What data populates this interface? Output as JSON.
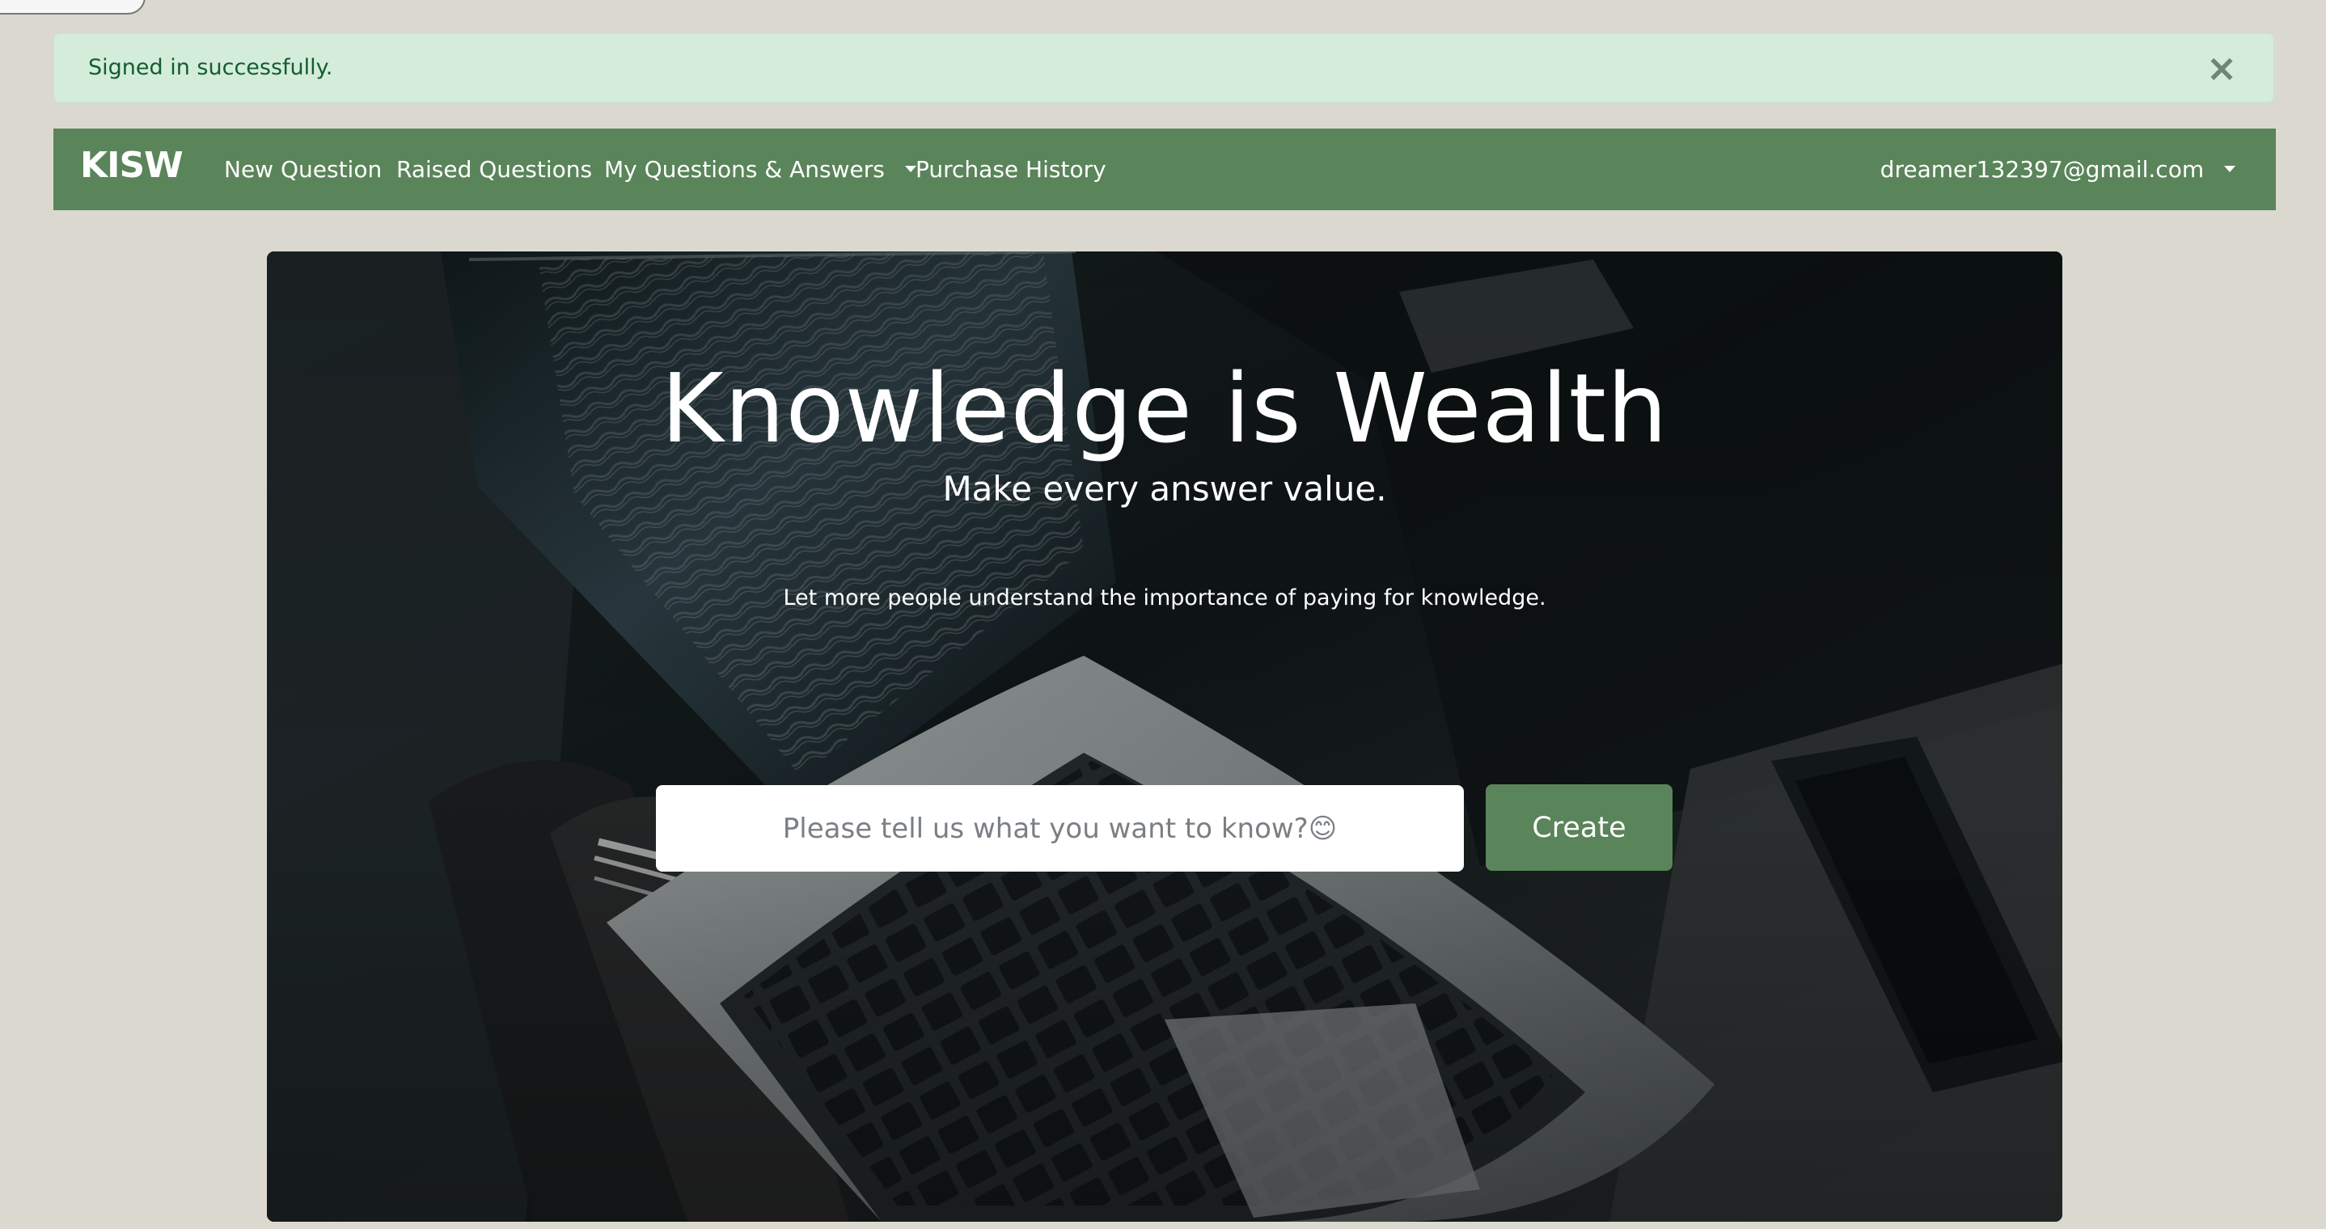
{
  "alert": {
    "message": "Signed in successfully.",
    "close_symbol": "×"
  },
  "navbar": {
    "brand": "KISW",
    "items": {
      "new_question": "New Question",
      "raised_questions": "Raised Questions",
      "my_questions_answers": "My Questions & Answers",
      "purchase_history": "Purchase History"
    },
    "user_email": "dreamer132397@gmail.com"
  },
  "hero": {
    "title": "Knowledge is Wealth",
    "subtitle": "Make every answer value.",
    "description": "Let more people understand the importance of paying for knowledge.",
    "input_placeholder": "Please tell us what you want to know?😊",
    "create_label": "Create"
  },
  "colors": {
    "background": "#dbd9cf",
    "alert_background": "#d4eddb",
    "alert_text": "#145c2f",
    "navbar": "#5a8459",
    "button": "#5a8459",
    "hero_dark": "#101617"
  },
  "icons": {
    "close": "close-icon",
    "dropdown": "chevron-down-icon"
  }
}
